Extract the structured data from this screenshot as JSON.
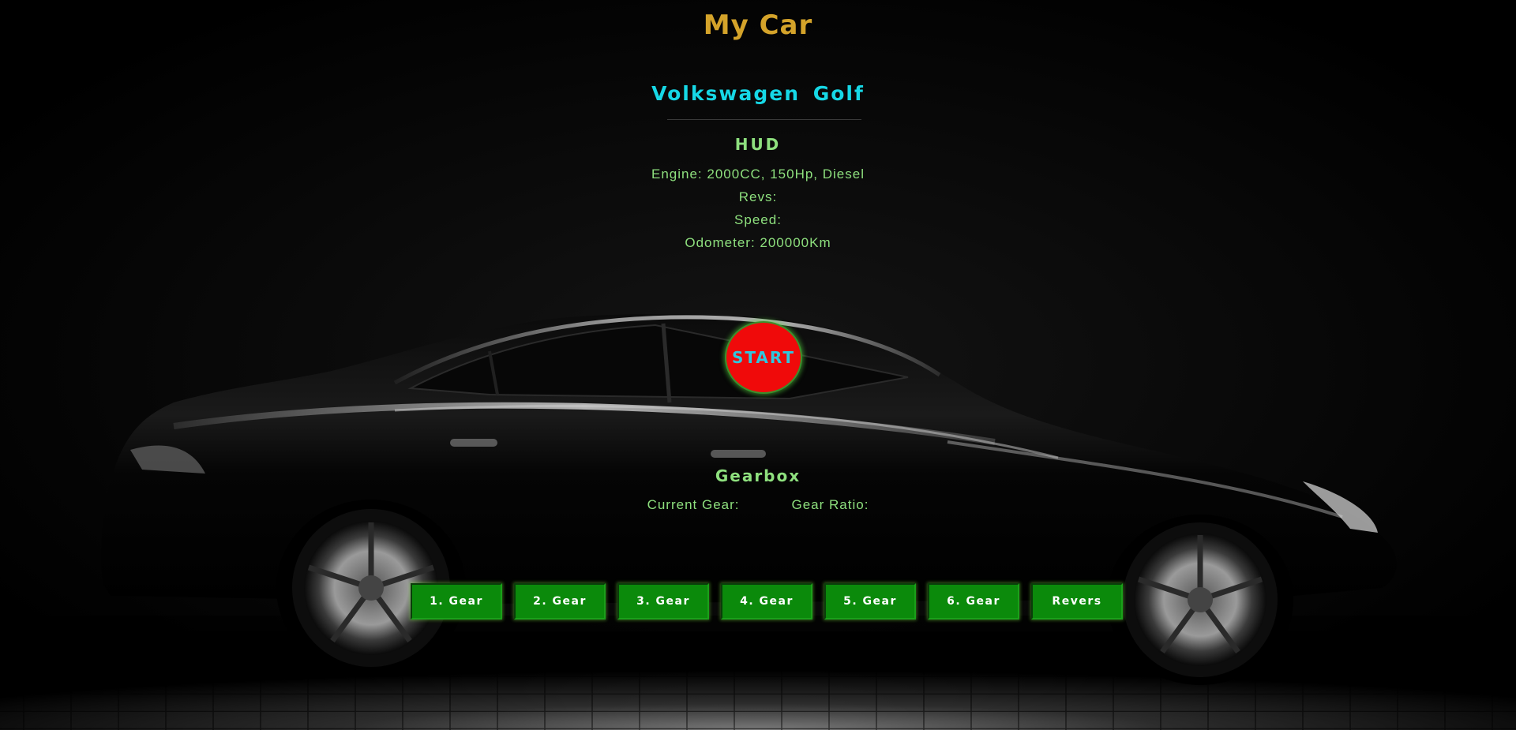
{
  "header": {
    "title": "My Car"
  },
  "car": {
    "name": "Volkswagen  Golf"
  },
  "hud": {
    "heading": "HUD",
    "engine": "Engine: 2000CC, 150Hp, Diesel",
    "revs": "Revs:",
    "speed": "Speed:",
    "odometer": "Odometer: 200000Km"
  },
  "controls": {
    "start_label": "START"
  },
  "gearbox": {
    "heading": "Gearbox",
    "current_gear_label": "Current Gear:",
    "gear_ratio_label": "Gear Ratio:",
    "buttons": [
      "1. Gear",
      "2. Gear",
      "3. Gear",
      "4. Gear",
      "5. Gear",
      "6. Gear",
      "Revers"
    ]
  },
  "colors": {
    "title": "#d4a32a",
    "car_name": "#16d8e6",
    "hud_text": "#8ee07e",
    "start_button": "#f00a0a",
    "gear_button": "#0b8a0b",
    "background": "#000000"
  },
  "icons": {
    "background": "car-silhouette-background"
  }
}
